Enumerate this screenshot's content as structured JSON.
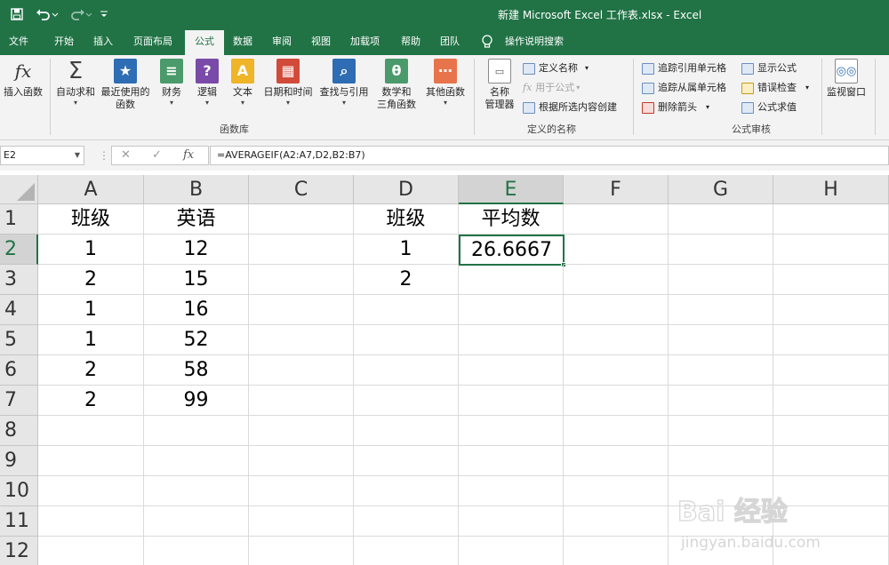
{
  "window": {
    "title": "新建 Microsoft Excel 工作表.xlsx  -  Excel"
  },
  "quick_access": {
    "save_icon": "save-icon",
    "undo_icon": "undo-icon",
    "redo_icon": "redo-icon",
    "customize_icon": "customize-icon"
  },
  "tabs": [
    {
      "label": "文件"
    },
    {
      "label": "开始"
    },
    {
      "label": "插入"
    },
    {
      "label": "页面布局"
    },
    {
      "label": "公式",
      "active": true
    },
    {
      "label": "数据"
    },
    {
      "label": "审阅"
    },
    {
      "label": "视图"
    },
    {
      "label": "加载项"
    },
    {
      "label": "帮助"
    },
    {
      "label": "团队"
    },
    {
      "label": "操作说明搜索"
    }
  ],
  "ribbon": {
    "insert_function": {
      "label": "插入函数",
      "icon": "fx"
    },
    "function_library": {
      "label": "函数库",
      "buttons": [
        {
          "label": "自动求和",
          "icon": "Σ",
          "color": "#404040"
        },
        {
          "label": "最近使用的\n函数",
          "icon": "★",
          "color": "#2e6db3"
        },
        {
          "label": "财务",
          "icon": "≡",
          "color": "#4b9a6b"
        },
        {
          "label": "逻辑",
          "icon": "?",
          "color": "#7a4aa8"
        },
        {
          "label": "文本",
          "icon": "A",
          "color": "#f0b429"
        },
        {
          "label": "日期和时间",
          "icon": "▦",
          "color": "#d24a3a"
        },
        {
          "label": "查找与引用",
          "icon": "⌕",
          "color": "#2e6db3"
        },
        {
          "label": "数学和\n三角函数",
          "icon": "θ",
          "color": "#4b9a6b"
        },
        {
          "label": "其他函数",
          "icon": "⋯",
          "color": "#e8744c"
        }
      ]
    },
    "defined_names": {
      "label": "定义的名称",
      "name_manager": "名称\n管理器",
      "define_name": "定义名称",
      "use_in_formula": "用于公式",
      "create_from_selection": "根据所选内容创建"
    },
    "formula_auditing": {
      "label": "公式审核",
      "trace_precedents": "追踪引用单元格",
      "trace_dependents": "追踪从属单元格",
      "remove_arrows": "删除箭头",
      "show_formulas": "显示公式",
      "error_checking": "错误检查",
      "evaluate_formula": "公式求值"
    },
    "watch_window": "监视窗口"
  },
  "formula_bar": {
    "name_box": "E2",
    "formula": "=AVERAGEIF(A2:A7,D2,B2:B7)"
  },
  "sheet": {
    "columns": [
      "A",
      "B",
      "C",
      "D",
      "E",
      "F",
      "G",
      "H"
    ],
    "rows": [
      "1",
      "2",
      "3",
      "4",
      "5",
      "6",
      "7",
      "8",
      "9",
      "10",
      "11",
      "12"
    ],
    "selected_cell": "E2",
    "cells": {
      "A1": "班级",
      "B1": "英语",
      "D1": "班级",
      "E1": "平均数",
      "A2": "1",
      "B2": "12",
      "D2": "1",
      "E2": "26.6667",
      "A3": "2",
      "B3": "15",
      "D3": "2",
      "A4": "1",
      "B4": "16",
      "A5": "1",
      "B5": "52",
      "A6": "2",
      "B6": "58",
      "A7": "2",
      "B7": "99"
    }
  },
  "watermark": {
    "brand": "Bai 经验",
    "url": "jingyan.baidu.com"
  }
}
